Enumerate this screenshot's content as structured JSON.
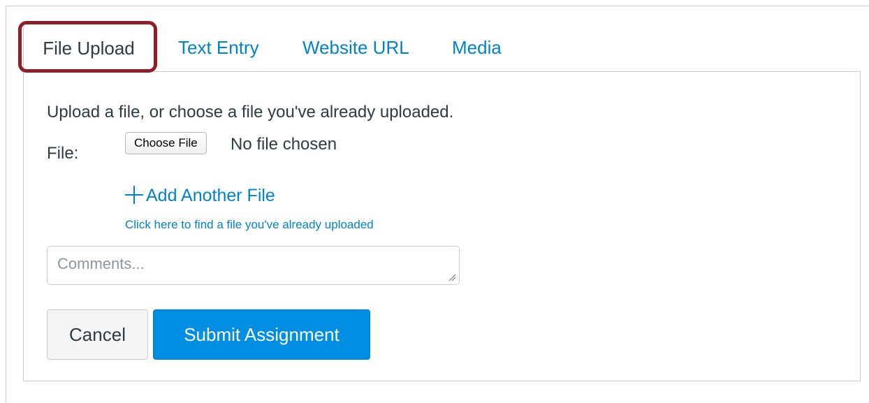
{
  "tabs": [
    {
      "label": "File Upload",
      "active": true
    },
    {
      "label": "Text Entry",
      "active": false
    },
    {
      "label": "Website URL",
      "active": false
    },
    {
      "label": "Media",
      "active": false
    }
  ],
  "upload": {
    "instruction": "Upload a file, or choose a file you've already uploaded.",
    "file_label": "File:",
    "choose_file_label": "Choose File",
    "no_file_text": "No file chosen",
    "add_another_file": "Add Another File",
    "find_uploaded_link": "Click here to find a file you've already uploaded",
    "comments_placeholder": "Comments...",
    "comments_value": ""
  },
  "actions": {
    "cancel_label": "Cancel",
    "submit_label": "Submit Assignment"
  },
  "colors": {
    "link": "#0084c9",
    "submit_bg": "#008ee2",
    "highlight_border": "#8e1f26",
    "text": "#2d3b45"
  },
  "icons": {
    "add_file": "plus-icon",
    "textarea_resize": "resize-grip-icon"
  }
}
